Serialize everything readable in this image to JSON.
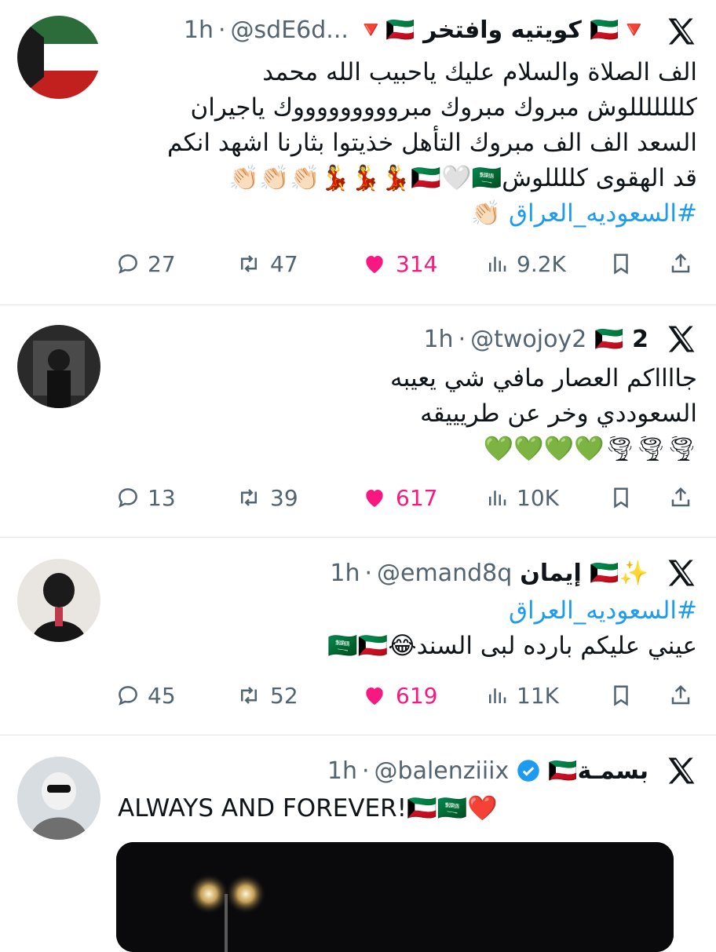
{
  "tweets": [
    {
      "name": "🔻🇰🇼 كويتيه وافتخر 🇰🇼🔻",
      "handle": "@sdE6d...",
      "time": "1h",
      "lines": [
        "الف الصلاة والسلام عليك ياحبيب الله محمد",
        "كلللللللوش مبروك مبروك مبروووووووووك ياجيران",
        "السعد الف الف مبروك التأهل خذيتوا بثارنا اشهد انكم",
        "قد الهقوى كللللوش🇰🇼🤍🇸🇦💃💃💃👏🏻👏🏻👏🏻"
      ],
      "hashtag_line": "#السعوديه_العراق 👏🏻",
      "replies": "27",
      "retweets": "47",
      "likes": "314",
      "views": "9.2K"
    },
    {
      "name": "2 🇰🇼",
      "handle": "@twojoy2",
      "time": "1h",
      "lines": [
        "جااااكم العصار مافي شي يعيبه",
        "السعوددي وخر عن طريييقه",
        "🌪🌪🌪💚💚💚💚"
      ],
      "replies": "13",
      "retweets": "39",
      "likes": "617",
      "views": "10K"
    },
    {
      "name": "✨🇰🇼 إيمان",
      "handle": "@emand8q",
      "time": "1h",
      "hashtag_line": "#السعوديه_العراق",
      "lines": [
        "عيني عليكم بارده لبى السند😂🇸🇦🇰🇼"
      ],
      "replies": "45",
      "retweets": "52",
      "likes": "619",
      "views": "11K"
    },
    {
      "name": "بسمـة🇰🇼",
      "handle": "@balenziiix",
      "time": "1h",
      "lines": [
        "ALWAYS AND FOREVER!🇰🇼🇸🇦❤️"
      ]
    }
  ],
  "colors": {
    "like": "#f91880",
    "hashtag": "#1d9bf0",
    "muted": "#536471",
    "verified": "#1d9bf0"
  },
  "icons": [
    "reply-icon",
    "retweet-icon",
    "heart-icon",
    "views-icon",
    "bookmark-icon",
    "share-icon",
    "x-logo-icon",
    "verified-badge-icon"
  ]
}
